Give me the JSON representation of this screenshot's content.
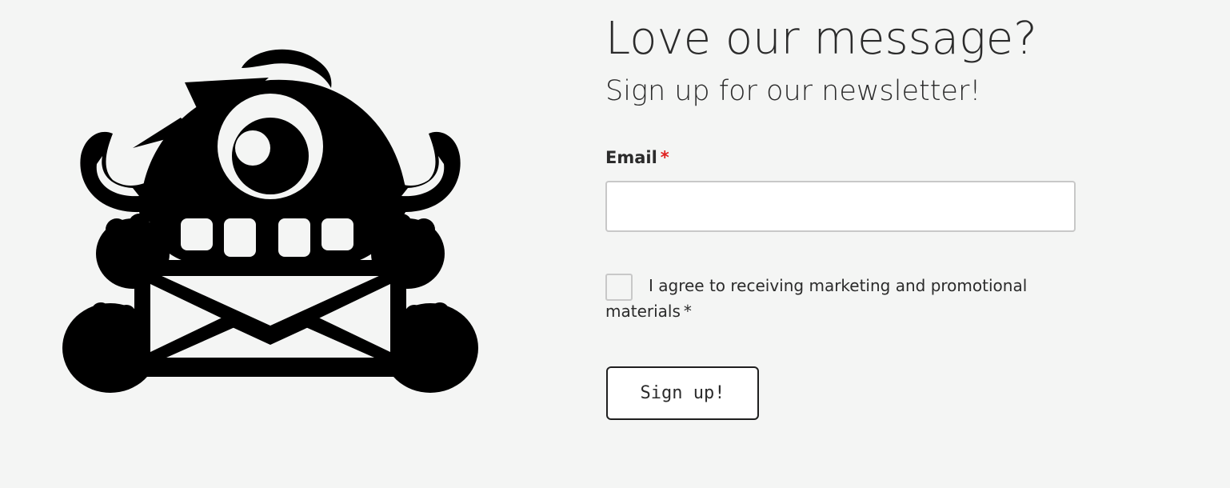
{
  "mascot": {
    "icon": "newsletter-monster-envelope-icon",
    "color": "#000000"
  },
  "newsletter": {
    "title": "Love our message?",
    "subtitle": "Sign up for our newsletter!",
    "email_label": "Email",
    "required_marker": "*",
    "email_value": "",
    "consent_text": "I agree to receiving marketing and promotional materials",
    "consent_checked": false,
    "submit_label": "Sign up!"
  },
  "colors": {
    "background": "#f4f5f4",
    "required": "#e02020",
    "text": "#2b2b2b"
  }
}
